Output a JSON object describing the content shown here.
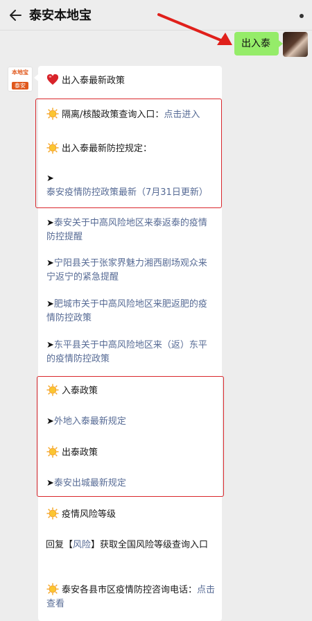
{
  "header": {
    "title": "泰安本地宝",
    "back_icon": "arrow-left-icon",
    "menu_icon": "more-dots-icon"
  },
  "outgoing_message": {
    "text": "出入泰"
  },
  "reply": {
    "heading": "出入泰最新政策",
    "section1": {
      "line1_label": "隔离/核酸政策查询入口：",
      "line1_link": "点击进入",
      "line2_label": "出入泰最新防控规定：",
      "policy_link_1": "泰安疫情防控政策最新（7月31日更新）"
    },
    "policy_links": [
      "泰安关于中高风险地区来泰返泰的疫情防控提醒",
      "宁阳县关于张家界魅力湘西剧场观众来宁返宁的紧急提醒",
      "肥城市关于中高风险地区来肥返肥的疫情防控政策",
      "东平县关于中高风险地区来（返）东平的疫情防控政策"
    ],
    "section2": {
      "enter_title": "入泰政策",
      "enter_link": "外地入泰最新规定",
      "exit_title": "出泰政策",
      "exit_link": "泰安出城最新规定"
    },
    "risk": {
      "title": "疫情风险等级",
      "reply_prefix": "回复【",
      "reply_keyword": "风险",
      "reply_suffix": "】获取全国风险等级查询入口"
    },
    "hotline": {
      "label": "泰安各县市区疫情防控咨询电话：",
      "link": "点击查看"
    }
  },
  "colors": {
    "link": "#576b95",
    "highlight_border": "#d9262b",
    "outgoing_bubble": "#95ec69",
    "background": "#ededed"
  },
  "icons": [
    "sun-emoji-icon",
    "heart-emoji-icon",
    "arrow-bullet-icon"
  ]
}
